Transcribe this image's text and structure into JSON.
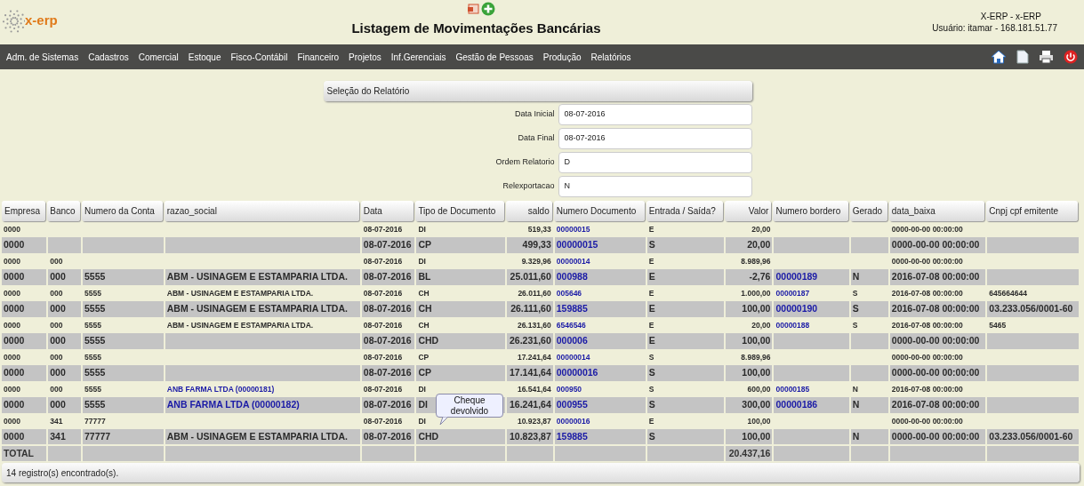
{
  "logo": {
    "text": "x-erp"
  },
  "page_title": "Listagem de Movimentações Bancárias",
  "user_info": {
    "system": "X-ERP - x-ERP",
    "user": "Usuário: itamar - 168.181.51.77"
  },
  "menu": [
    "Adm. de Sistemas",
    "Cadastros",
    "Comercial",
    "Estoque",
    "Fisco-Contábil",
    "Financeiro",
    "Projetos",
    "Inf.Gerenciais",
    "Gestão de Pessoas",
    "Produção",
    "Relatórios"
  ],
  "selection": {
    "title": "Seleção do Relatório",
    "fields": [
      {
        "label": "Data Inicial",
        "value": "08-07-2016"
      },
      {
        "label": "Data Final",
        "value": "08-07-2016"
      },
      {
        "label": "Ordem Relatorio",
        "value": "D"
      },
      {
        "label": "Relexportacao",
        "value": "N"
      }
    ]
  },
  "table": {
    "columns": [
      {
        "label": "Empresa",
        "kind": "text"
      },
      {
        "label": "Banco",
        "kind": "text"
      },
      {
        "label": "Numero da Conta",
        "kind": "text"
      },
      {
        "label": "razao_social",
        "kind": "text"
      },
      {
        "label": "Data",
        "kind": "text"
      },
      {
        "label": "Tipo de Documento",
        "kind": "text"
      },
      {
        "label": "saldo",
        "kind": "number"
      },
      {
        "label": "Numero Documento",
        "kind": "link"
      },
      {
        "label": "Entrada / Saída?",
        "kind": "text"
      },
      {
        "label": "Valor",
        "kind": "number"
      },
      {
        "label": "Numero bordero",
        "kind": "link"
      },
      {
        "label": "Gerado",
        "kind": "text"
      },
      {
        "label": "data_baixa",
        "kind": "text"
      },
      {
        "label": "Cnpj cpf emitente",
        "kind": "text"
      }
    ],
    "rows": [
      {
        "cells": [
          "0000",
          "",
          "",
          "",
          "08-07-2016",
          "DI",
          "519,33",
          "00000015",
          "E",
          "20,00",
          "",
          "",
          "0000-00-00 00:00:00",
          ""
        ]
      },
      {
        "cells": [
          "0000",
          "",
          "",
          "",
          "08-07-2016",
          "CP",
          "499,33",
          "00000015",
          "S",
          "20,00",
          "",
          "",
          "0000-00-00 00:00:00",
          ""
        ]
      },
      {
        "cells": [
          "0000",
          "000",
          "",
          "",
          "08-07-2016",
          "DI",
          "9.329,96",
          "00000014",
          "E",
          "8.989,96",
          "",
          "",
          "0000-00-00 00:00:00",
          ""
        ]
      },
      {
        "cells": [
          "0000",
          "000",
          "5555",
          "ABM - USINAGEM E ESTAMPARIA LTDA.",
          "08-07-2016",
          "BL",
          "25.011,60",
          "000988",
          "E",
          "-2,76",
          "00000189",
          "N",
          "2016-07-08 00:00:00",
          ""
        ],
        "razao_link": false
      },
      {
        "cells": [
          "0000",
          "000",
          "5555",
          "ABM - USINAGEM E ESTAMPARIA LTDA.",
          "08-07-2016",
          "CH",
          "26.011,60",
          "005646",
          "E",
          "1.000,00",
          "00000187",
          "S",
          "2016-07-08 00:00:00",
          "645664644"
        ],
        "razao_link": false
      },
      {
        "cells": [
          "0000",
          "000",
          "5555",
          "ABM - USINAGEM E ESTAMPARIA LTDA.",
          "08-07-2016",
          "CH",
          "26.111,60",
          "159885",
          "E",
          "100,00",
          "00000190",
          "S",
          "2016-07-08 00:00:00",
          "03.233.056/0001-60"
        ],
        "razao_link": false
      },
      {
        "cells": [
          "0000",
          "000",
          "5555",
          "ABM - USINAGEM E ESTAMPARIA LTDA.",
          "08-07-2016",
          "CH",
          "26.131,60",
          "6546546",
          "E",
          "20,00",
          "00000188",
          "S",
          "2016-07-08 00:00:00",
          "5465"
        ],
        "razao_link": false
      },
      {
        "cells": [
          "0000",
          "000",
          "5555",
          "",
          "08-07-2016",
          "CHD",
          "26.231,60",
          "000006",
          "E",
          "100,00",
          "",
          "",
          "0000-00-00 00:00:00",
          ""
        ]
      },
      {
        "cells": [
          "0000",
          "000",
          "5555",
          "",
          "08-07-2016",
          "CP",
          "17.241,64",
          "00000014",
          "S",
          "8.989,96",
          "",
          "",
          "0000-00-00 00:00:00",
          ""
        ]
      },
      {
        "cells": [
          "0000",
          "000",
          "5555",
          "",
          "08-07-2016",
          "CP",
          "17.141,64",
          "00000016",
          "S",
          "100,00",
          "",
          "",
          "0000-00-00 00:00:00",
          ""
        ]
      },
      {
        "cells": [
          "0000",
          "000",
          "5555",
          "ANB FARMA LTDA (00000181)",
          "08-07-2016",
          "DI",
          "16.541,64",
          "000950",
          "S",
          "600,00",
          "00000185",
          "N",
          "2016-07-08 00:00:00",
          ""
        ],
        "razao_link": true
      },
      {
        "cells": [
          "0000",
          "000",
          "5555",
          "ANB FARMA LTDA (00000182)",
          "08-07-2016",
          "DI",
          "16.241,64",
          "000955",
          "S",
          "300,00",
          "00000186",
          "N",
          "2016-07-08 00:00:00",
          ""
        ],
        "razao_link": true
      },
      {
        "cells": [
          "0000",
          "341",
          "77777",
          "",
          "08-07-2016",
          "DI",
          "10.923,87",
          "00000016",
          "E",
          "100,00",
          "",
          "",
          "0000-00-00 00:00:00",
          ""
        ]
      },
      {
        "cells": [
          "0000",
          "341",
          "77777",
          "ABM - USINAGEM E ESTAMPARIA LTDA.",
          "08-07-2016",
          "CHD",
          "10.823,87",
          "159885",
          "S",
          "100,00",
          "",
          "N",
          "0000-00-00 00:00:00",
          "03.233.056/0001-60"
        ],
        "razao_link": false,
        "tooltip": "Cheque devolvido"
      }
    ],
    "total_row": {
      "label": "TOTAL",
      "valor": "20.437,16"
    }
  },
  "footer": "14 registro(s) encontrado(s)."
}
